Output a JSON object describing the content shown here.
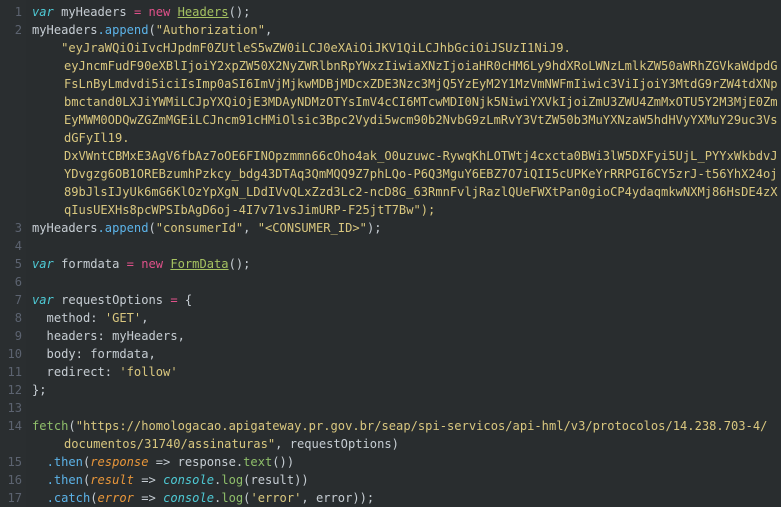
{
  "editor": {
    "language": "javascript",
    "theme_background": "#292d2f",
    "gutter_background": "#2a2e30",
    "line_number_color": "#5c6370",
    "default_text_color": "#c6cdd3",
    "colors": {
      "keyword": "#4ec9d4",
      "keyword_alt": "#e0518a",
      "type": "#a5c261",
      "property": "#5cb3e8",
      "function": "#8fbf6a",
      "string": "#d9c77f",
      "parameter": "#e8963a"
    },
    "total_visible_lines": 17,
    "wrapped_lines": [
      2,
      14
    ]
  },
  "code": {
    "lines": [
      {
        "number": "1",
        "text": "var myHeaders = new Headers();"
      },
      {
        "number": "2",
        "text": "myHeaders.append(\"Authorization\","
      },
      {
        "number": "",
        "text": "    \"eyJraWQiOiIvcHJpdmF0ZUtleS5wZW0iLCJ0eXAiOiJKV1QiLCJhbGciOiJSUzI1NiJ9."
      },
      {
        "number": "",
        "text": "eyJncmFudF90eXBlIjoiY2xpZW50X2NyZWRlbnRpYWxzIiwiaXNzIjoiaHR0cHM6Ly9hdXRoLWNzLmlkZW50aWRhZGVkaWdpdG"
      },
      {
        "number": "",
        "text": "FsLnByLmdvdi5iciIsImp0aSI6ImVjMjkwMDBjMDcxZDE3Nzc3MjQ5YzEyM2Y1MzVmNWFmIiwic3ViIjoiY3MtdG9rZW4tdXNp"
      },
      {
        "number": "",
        "text": "bmctand0LXJiYWMiLCJpYXQiOjE3MDAyNDMzOTYsImV4cCI6MTcwMDI0Njk5NiwiYXVkIjoiZmU3ZWU4ZmMxOTU5Y2M3MjE0Zm"
      },
      {
        "number": "",
        "text": "EyMWM0ODQwZGZmMGEiLCJncm91cHMiOlsic3Bpc2Vydi5wcm90b2NvbG9zLmRvY3VtZW50b3MuYXNzaW5hdHVyYXMuY29uc3Vs"
      },
      {
        "number": "",
        "text": "dGFyIl19."
      },
      {
        "number": "",
        "text": "DxVWntCBMxE3AgV6fbAz7oOE6FINOpzmmn66cOho4ak_O0uzuwc-RywqKhLOTWtj4cxcta0BWi3lW5DXFyi5UjL_PYYxWkbdvJ"
      },
      {
        "number": "",
        "text": "YDvgzg6OB1OREBzumhPzkcy_bdg43DTAq3QmMQQ9Z7phLQo-P6Q3MguY6EBZ7O7iQII5cUPKeYrRRPGI6CY5zrJ-t56YhX24oj"
      },
      {
        "number": "",
        "text": "89bJlsIJyUk6mG6KlOzYpXgN_LDdIVvQLxZzd3Lc2-ncD8G_63RmnFvljRazlQUeFWXtPan0gioCP4ydaqmkwNXMj86HsDE4zX"
      },
      {
        "number": "",
        "text": "qIusUEXHs8pcWPSIbAgD6oj-4I7v71vsJimURP-F25jtT7Bw\");"
      },
      {
        "number": "3",
        "text": "myHeaders.append(\"consumerId\", \"<CONSUMER_ID>\");"
      },
      {
        "number": "4",
        "text": ""
      },
      {
        "number": "5",
        "text": "var formdata = new FormData();"
      },
      {
        "number": "6",
        "text": ""
      },
      {
        "number": "7",
        "text": "var requestOptions = {"
      },
      {
        "number": "8",
        "text": "  method: 'GET',"
      },
      {
        "number": "9",
        "text": "  headers: myHeaders,"
      },
      {
        "number": "10",
        "text": "  body: formdata,"
      },
      {
        "number": "11",
        "text": "  redirect: 'follow'"
      },
      {
        "number": "12",
        "text": "};"
      },
      {
        "number": "13",
        "text": ""
      },
      {
        "number": "14",
        "text": "fetch(\"https://homologacao.apigateway.pr.gov.br/seap/spi-servicos/api-hml/v3/protocolos/14.238.703-4/"
      },
      {
        "number": "",
        "text": "    documentos/31740/assinaturas\", requestOptions)"
      },
      {
        "number": "15",
        "text": "  .then(response => response.text())"
      },
      {
        "number": "16",
        "text": "  .then(result => console.log(result))"
      },
      {
        "number": "17",
        "text": "  .catch(error => console.log('error', error));"
      }
    ],
    "tokens": {
      "line1": {
        "keyword": "var",
        "identifier": "myHeaders",
        "equals": "=",
        "new": "new",
        "type": "Headers",
        "call": "();"
      },
      "line2": {
        "object": "myHeaders",
        "method": ".append",
        "arg1": "\"Authorization\""
      },
      "line3": {
        "object": "myHeaders",
        "method": ".append",
        "arg1": "\"consumerId\"",
        "arg2": "\"<CONSUMER_ID>\""
      },
      "line5": {
        "keyword": "var",
        "identifier": "formdata",
        "new": "new",
        "type": "FormData"
      },
      "line7": {
        "keyword": "var",
        "identifier": "requestOptions"
      },
      "line8": {
        "key": "method:",
        "value": "'GET'"
      },
      "line9": {
        "key": "headers:",
        "value": "myHeaders"
      },
      "line10": {
        "key": "body:",
        "value": "formdata"
      },
      "line11": {
        "key": "redirect:",
        "value": "'follow'"
      },
      "line14": {
        "fn": "fetch",
        "url": "https://homologacao.apigateway.pr.gov.br/seap/spi-servicos/api-hml/v3/protocolos/14.238.703-4/documentos/31740/assinaturas",
        "arg2": "requestOptions"
      },
      "line15": {
        "method": ".then",
        "param": "response",
        "arrow": "=>",
        "body": "response.text()"
      },
      "line16": {
        "method": ".then",
        "param": "result",
        "arrow": "=>",
        "body": "console.log(result)"
      },
      "line17": {
        "method": ".catch",
        "param": "error",
        "arrow": "=>",
        "body": "console.log('error', error)"
      }
    }
  }
}
